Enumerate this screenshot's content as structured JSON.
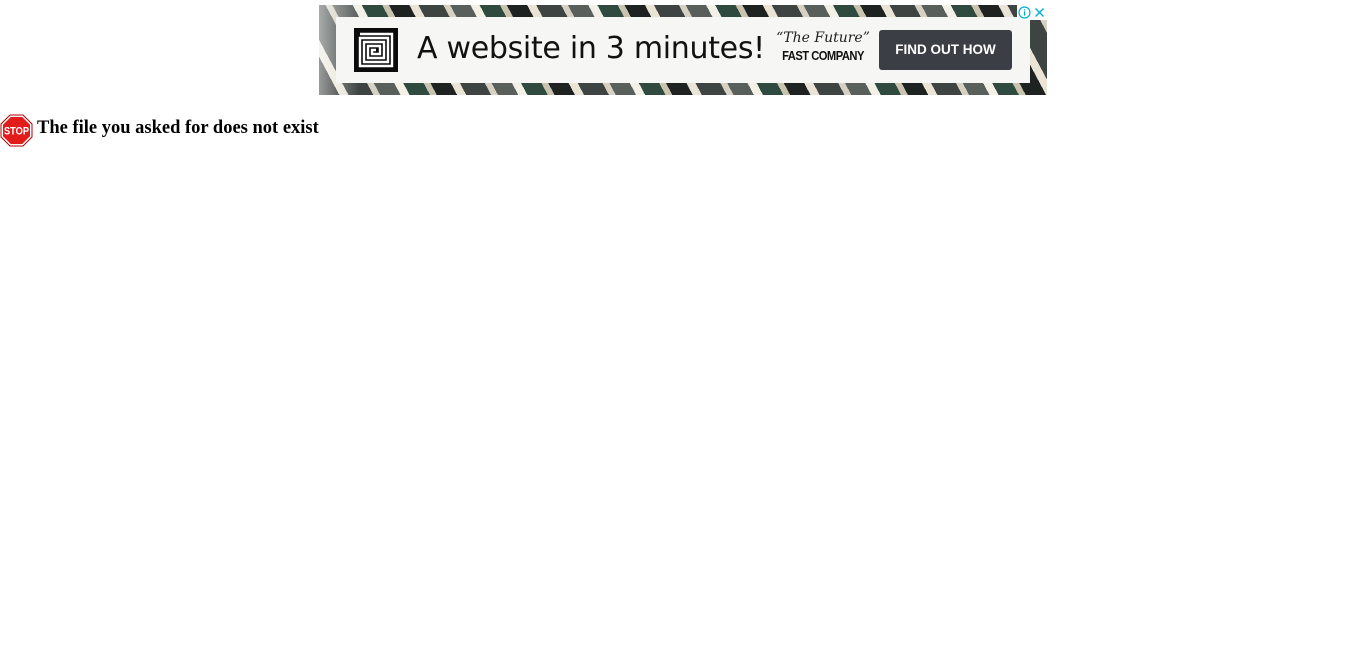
{
  "ad": {
    "headline": "A website in 3 minutes!",
    "quote": "“The Future”",
    "brand": "FAST COMPANY",
    "cta_label": "FIND OUT HOW",
    "logo_icon": "maze-square-logo",
    "choices_icon": "info-circle-icon",
    "close_icon": "close-icon",
    "colors": {
      "panel": "#f6f6f4",
      "cta_bg": "#3b3e44",
      "cta_text": "#ffffff",
      "choices": "#00aecd"
    }
  },
  "error": {
    "icon": "stop-sign-icon",
    "icon_text": "STOP",
    "message": "The file you asked for does not exist",
    "colors": {
      "stop_fill": "#e21b1b"
    }
  }
}
